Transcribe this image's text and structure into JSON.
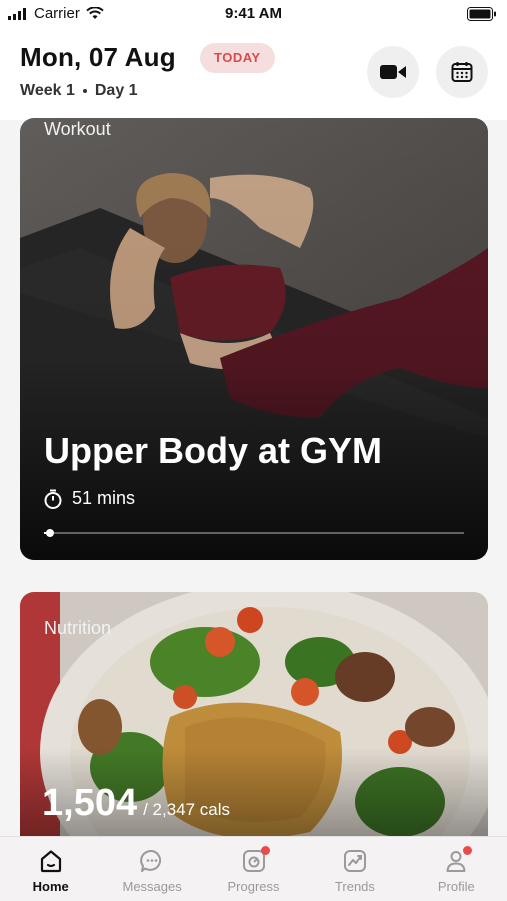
{
  "status_bar": {
    "carrier": "Carrier",
    "time": "9:41 AM"
  },
  "header": {
    "date": "Mon, 07 Aug",
    "badge": "TODAY",
    "week": "Week 1",
    "day": "Day 1",
    "video_icon": "video-camera-icon",
    "calendar_icon": "calendar-icon"
  },
  "workout": {
    "label": "Workout",
    "title": "Upper Body at GYM",
    "duration": "51 mins",
    "progress": 0.01
  },
  "nutrition": {
    "label": "Nutrition",
    "calories": "1,504",
    "goal": "/ 2,347 cals"
  },
  "tabs": [
    {
      "label": "Home",
      "icon": "home-icon",
      "active": true,
      "badge": false
    },
    {
      "label": "Messages",
      "icon": "chat-bubble-icon",
      "active": false,
      "badge": false
    },
    {
      "label": "Progress",
      "icon": "progress-icon",
      "active": false,
      "badge": true
    },
    {
      "label": "Trends",
      "icon": "trend-chart-icon",
      "active": false,
      "badge": false
    },
    {
      "label": "Profile",
      "icon": "user-icon",
      "active": false,
      "badge": true
    }
  ],
  "colors": {
    "accent": "#e94b4b",
    "badge_bg": "#f6dede",
    "tab_inactive": "#9a9a9a"
  }
}
